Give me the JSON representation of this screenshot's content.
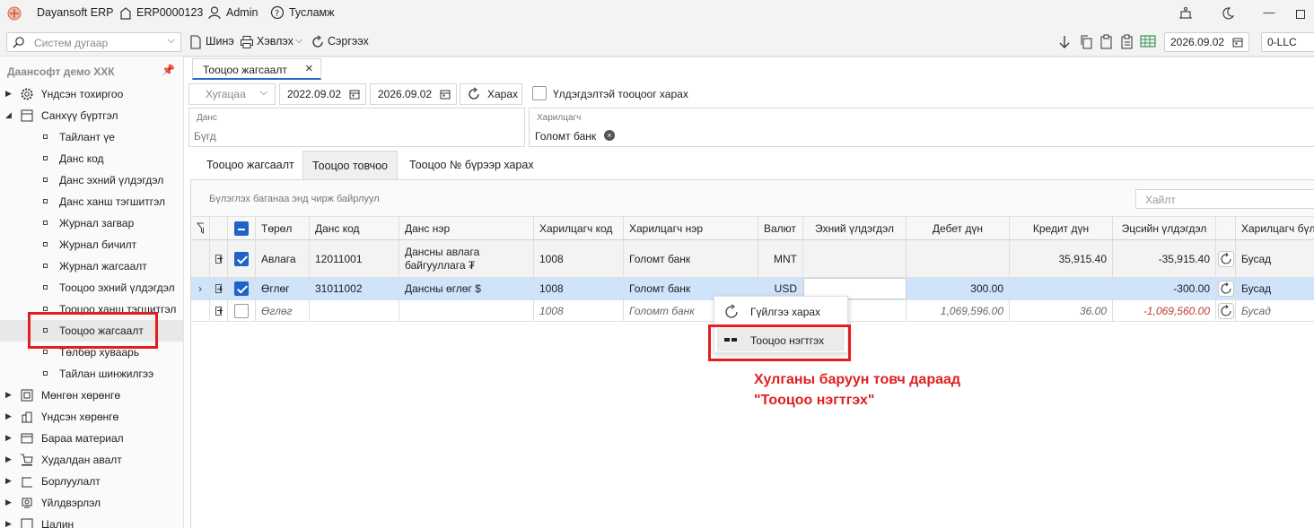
{
  "titlebar": {
    "app_name": "Dayansoft ERP",
    "database": "ERP0000123",
    "user": "Admin",
    "help": "Тусламж"
  },
  "toolbar": {
    "search_placeholder": "Систем дугаар",
    "new_label": "Шинэ",
    "print_label": "Хэвлэх",
    "refresh_label": "Сэргээх",
    "date": "2026.09.02",
    "company": "0-LLC"
  },
  "sidebar": {
    "header": "Даансофт демо ХХК",
    "items": [
      {
        "label": "Үндсэн тохиргоо",
        "level": 0,
        "expanded": false,
        "icon": "gear-icon"
      },
      {
        "label": "Санхүү бүртгэл",
        "level": 0,
        "expanded": true,
        "icon": "ledger-icon"
      },
      {
        "label": "Тайлант үе",
        "level": 1
      },
      {
        "label": "Данс код",
        "level": 1
      },
      {
        "label": "Данс эхний үлдэгдэл",
        "level": 1
      },
      {
        "label": "Данс ханш тэгшитгэл",
        "level": 1
      },
      {
        "label": "Журнал загвар",
        "level": 1
      },
      {
        "label": "Журнал бичилт",
        "level": 1
      },
      {
        "label": "Журнал жагсаалт",
        "level": 1
      },
      {
        "label": "Тооцоо эхний үлдэгдэл",
        "level": 1
      },
      {
        "label": "Тооцоо ханш тэгшитгэл",
        "level": 1
      },
      {
        "label": "Тооцоо жагсаалт",
        "level": 1,
        "selected": true
      },
      {
        "label": "Төлбөр хуваарь",
        "level": 1
      },
      {
        "label": "Тайлан шинжилгээ",
        "level": 1
      },
      {
        "label": "Мөнгөн хөрөнгө",
        "level": 0,
        "expanded": false,
        "icon": "cash-icon"
      },
      {
        "label": "Үндсэн хөрөнгө",
        "level": 0,
        "expanded": false,
        "icon": "building-icon"
      },
      {
        "label": "Бараа материал",
        "level": 0,
        "expanded": false,
        "icon": "box-icon"
      },
      {
        "label": "Худалдан авалт",
        "level": 0,
        "expanded": false,
        "icon": "cart-icon"
      },
      {
        "label": "Борлуулалт",
        "level": 0,
        "expanded": false,
        "icon": "sales-icon"
      },
      {
        "label": "Үйлдвэрлэл",
        "level": 0,
        "expanded": false,
        "icon": "factory-icon"
      },
      {
        "label": "Цалин",
        "level": 0,
        "expanded": false,
        "icon": "salary-icon"
      }
    ]
  },
  "document_tab": {
    "label": "Тооцоо жагсаалт"
  },
  "filters": {
    "period_placeholder": "Хугацаа",
    "date_from": "2022.09.02",
    "date_to": "2026.09.02",
    "view_button": "Харах",
    "show_balance_label": "Үлдэгдэлтэй тооцоог харах",
    "account_label": "Данс",
    "account_value": "Бүгд",
    "partner_label": "Харилцагч",
    "partner_value": "Голомт банк"
  },
  "sub_tabs": [
    {
      "label": "Тооцоо жагсаалт",
      "active": false
    },
    {
      "label": "Тооцоо товчоо",
      "active": true
    },
    {
      "label": "Тооцоо № бүрээр харах",
      "active": false
    }
  ],
  "grid": {
    "group_hint": "Бүлэглэх баганаа энд чирж байрлуул",
    "search_placeholder": "Хайлт",
    "columns": [
      "Төрөл",
      "Данс код",
      "Данс нэр",
      "Харилцагч код",
      "Харилцагч нэр",
      "Валют",
      "Эхний үлдэгдэл",
      "Дебет дүн",
      "Кредит дүн",
      "Эцсийн үлдэгдэл",
      "Харилцагч бүл"
    ],
    "rows": [
      {
        "type": "Авлага",
        "account_code": "12011001",
        "account_name": "Дансны авлага байгууллага ₮",
        "partner_code": "1008",
        "partner_name": "Голомт банк",
        "currency": "MNT",
        "opening": "",
        "debit": "",
        "credit": "35,915.40",
        "closing": "-35,915.40",
        "group": "Бусад",
        "checked": true
      },
      {
        "type": "Өглөг",
        "account_code": "31011002",
        "account_name": "Дансны өглөг $",
        "partner_code": "1008",
        "partner_name": "Голомт банк",
        "currency": "USD",
        "opening": "",
        "debit": "300.00",
        "credit": "",
        "closing": "-300.00",
        "group": "Бусад",
        "checked": true
      },
      {
        "type": "Өглөг",
        "account_code": "",
        "account_name": "",
        "partner_code": "1008",
        "partner_name": "Голомт банк",
        "currency": "",
        "opening": "",
        "debit": "1,069,596.00",
        "credit": "36.00",
        "closing": "-1,069,560.00",
        "group": "Бусад",
        "checked": false
      }
    ]
  },
  "context_menu": {
    "items": [
      "Гүйлгээ харах",
      "Тооцоо нэгтгэх"
    ]
  },
  "annotation": {
    "line1": "Хулганы баруун товч дараад",
    "line2": "\"Тооцоо нэгтгэх\""
  },
  "colors": {
    "accent": "#1e64c8",
    "highlight": "#cfe3fb",
    "annotation": "#e02020"
  }
}
